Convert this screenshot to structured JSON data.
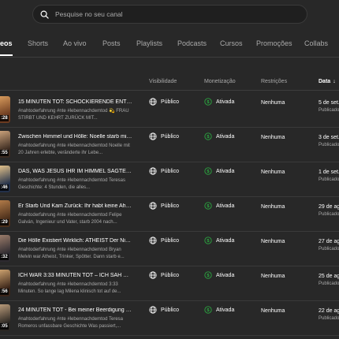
{
  "search": {
    "placeholder": "Pesquise no seu canal"
  },
  "tabs": [
    "eos",
    "Shorts",
    "Ao vivo",
    "Posts",
    "Playlists",
    "Podcasts",
    "Cursos",
    "Promoções",
    "Collabs"
  ],
  "columns": {
    "visibility": "Visibilidade",
    "monetization": "Monetização",
    "restrictions": "Restrições",
    "date": "Data",
    "date_sort": "↓"
  },
  "colors": {
    "background": "#282828",
    "monetized_green": "#2ba640"
  },
  "rows": [
    {
      "title": "15 MINUTEN TOT: SCHOCKIERENDE ENTHÜL...",
      "desc": "#nahtoderfahrung #nte #lebennachdemtod 💫 FRAU STIRBT UND KEHRT ZURÜCK MIT...",
      "duration": ":28",
      "visibility": "Público",
      "monetization": "Ativada",
      "restrictions": "Nenhuma",
      "date": "5 de set.",
      "status": "Publicado"
    },
    {
      "title": "Zwischen Himmel und Hölle: Noelle starb mit ...",
      "desc": "#nahtoderfahrung #nte #lebennachdemtod Noelle mit 20 Jahren erlebte, veränderte ihr Lebe...",
      "duration": ":55",
      "visibility": "Público",
      "monetization": "Ativada",
      "restrictions": "Nenhuma",
      "date": "3 de set.",
      "status": "Publicado"
    },
    {
      "title": "DAS, WAS JESUS IHR IM HIMMEL SAGTE, WI...",
      "desc": "#nahtoderfahrung #nte #lebennachdemtod Teresas Geschichte: 4 Stunden, die alles...",
      "duration": ":46",
      "visibility": "Público",
      "monetization": "Ativada",
      "restrictions": "Nenhuma",
      "date": "1 de set.",
      "status": "Publicado"
    },
    {
      "title": "Er Starb Und Kam Zurück: Ihr habt keine Ahnu...",
      "desc": "#nahtoderfahrung #nte #lebennachdemtod Felipe Galván, Ingenieur und Vater, starb 2004 nach...",
      "duration": ":29",
      "visibility": "Público",
      "monetization": "Ativada",
      "restrictions": "Nenhuma",
      "date": "29 de ag",
      "status": "Publicado"
    },
    {
      "title": "Die Hölle Existiert Wirklich: ATHEIST Der Nie E...",
      "desc": "#nahtoderfahrung #nte #lebennachdemtod Bryan Melvin war Atheist, Trinker, Spötter. Dann starb e...",
      "duration": ":32",
      "visibility": "Público",
      "monetization": "Ativada",
      "restrictions": "Nenhuma",
      "date": "27 de ag",
      "status": "Publicado"
    },
    {
      "title": "ICH WAR 3:33 MINUTEN TOT – ICH SAH DIE J...",
      "desc": "#nahtoderfahrung #nte #lebennachdemtod 3:33 Minuten. So lange lag Milena klinisch tot auf de...",
      "duration": ":56",
      "visibility": "Público",
      "monetization": "Ativada",
      "restrictions": "Nenhuma",
      "date": "25 de ag",
      "status": "Publicado"
    },
    {
      "title": "24 MINUTEN TOT - Bei meiner Beerdigung sag...",
      "desc": "#nahtoderfahrung #nte #lebennachdemtod Teresa Romeros unfassbare Geschichte Was passiert,...",
      "duration": ":05",
      "visibility": "Público",
      "monetization": "Ativada",
      "restrictions": "Nenhuma",
      "date": "22 de ag",
      "status": "Publicado"
    }
  ]
}
